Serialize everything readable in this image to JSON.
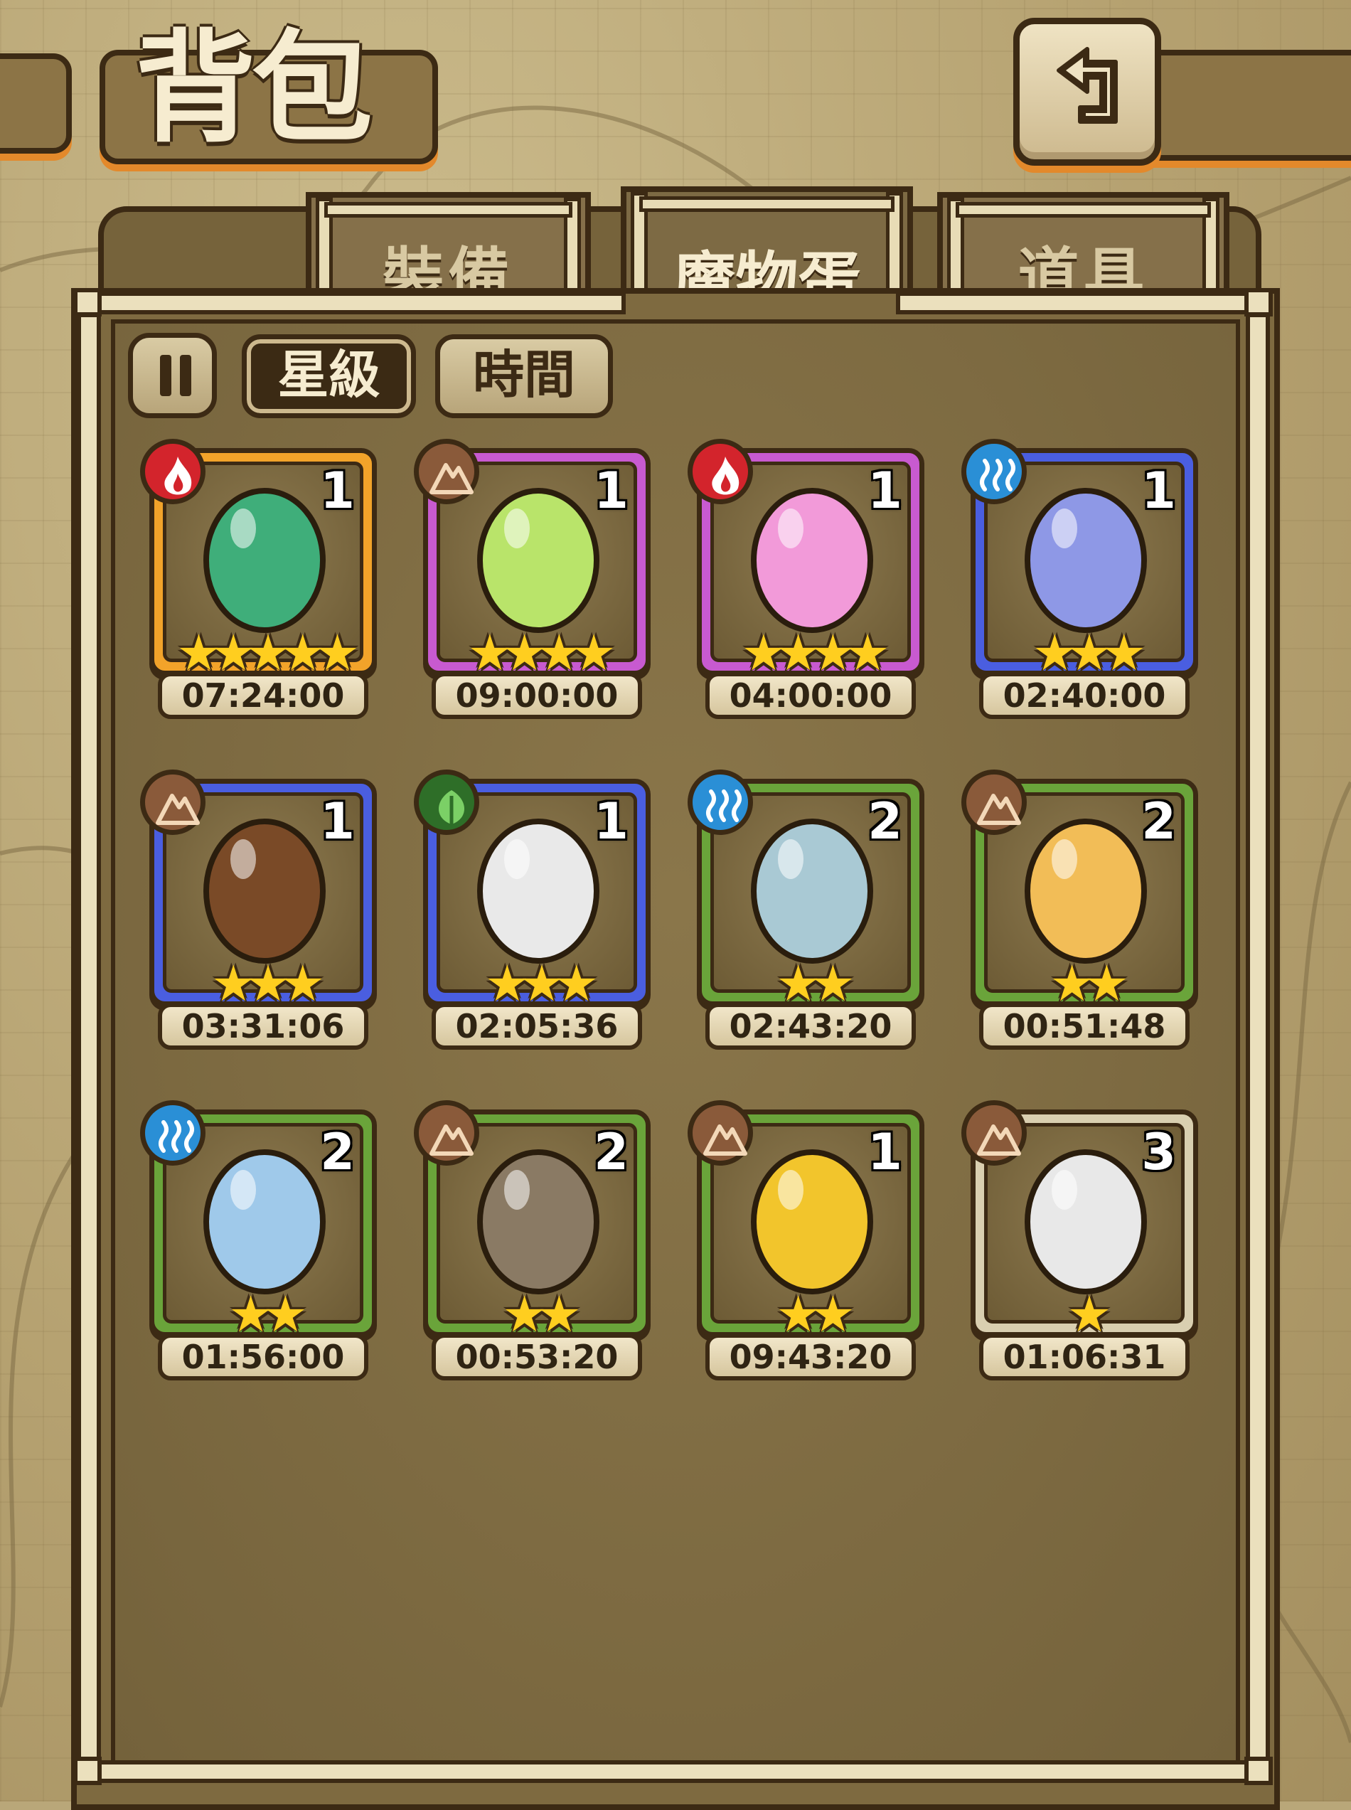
{
  "header": {
    "title": "背包",
    "back_icon": "back-arrow-icon"
  },
  "tabs": [
    {
      "label": "裝備",
      "active": false
    },
    {
      "label": "魔物蛋",
      "active": true
    },
    {
      "label": "道具",
      "active": false
    }
  ],
  "sort": {
    "toggle_icon": "pause-toggle-icon",
    "star_label": "星級",
    "time_label": "時間",
    "selected": "星級"
  },
  "eggs": [
    {
      "count": "1",
      "stars": 5,
      "timer": "07:24:00",
      "element": "fire",
      "rarity_color": "#f2a32a",
      "egg_color": "#3fae7a"
    },
    {
      "count": "1",
      "stars": 4,
      "timer": "09:00:00",
      "element": "earth",
      "rarity_color": "#c85ad0",
      "egg_color": "#b9e46a"
    },
    {
      "count": "1",
      "stars": 4,
      "timer": "04:00:00",
      "element": "fire",
      "rarity_color": "#c85ad0",
      "egg_color": "#f29ad9"
    },
    {
      "count": "1",
      "stars": 3,
      "timer": "02:40:00",
      "element": "water",
      "rarity_color": "#4a5ee0",
      "egg_color": "#8e98e6"
    },
    {
      "count": "1",
      "stars": 3,
      "timer": "03:31:06",
      "element": "earth",
      "rarity_color": "#4a5ee0",
      "egg_color": "#7a4a27"
    },
    {
      "count": "1",
      "stars": 3,
      "timer": "02:05:36",
      "element": "wood",
      "rarity_color": "#4a5ee0",
      "egg_color": "#e9e9e9"
    },
    {
      "count": "2",
      "stars": 2,
      "timer": "02:43:20",
      "element": "water",
      "rarity_color": "#6aa43a",
      "egg_color": "#a9c9d4"
    },
    {
      "count": "2",
      "stars": 2,
      "timer": "00:51:48",
      "element": "earth",
      "rarity_color": "#6aa43a",
      "egg_color": "#f2bd57"
    },
    {
      "count": "2",
      "stars": 2,
      "timer": "01:56:00",
      "element": "water",
      "rarity_color": "#6aa43a",
      "egg_color": "#9fc9ea"
    },
    {
      "count": "2",
      "stars": 2,
      "timer": "00:53:20",
      "element": "earth",
      "rarity_color": "#6aa43a",
      "egg_color": "#8a7a64"
    },
    {
      "count": "1",
      "stars": 2,
      "timer": "09:43:20",
      "element": "earth",
      "rarity_color": "#6aa43a",
      "egg_color": "#f2c52c"
    },
    {
      "count": "3",
      "stars": 1,
      "timer": "01:06:31",
      "element": "earth",
      "rarity_color": "#d9cfb0",
      "egg_color": "#e8e8e8"
    }
  ],
  "colors": {
    "fire": "#d3242c",
    "earth": "#8a5a3a",
    "water": "#2a8fd6",
    "wood": "#2e6e28"
  }
}
